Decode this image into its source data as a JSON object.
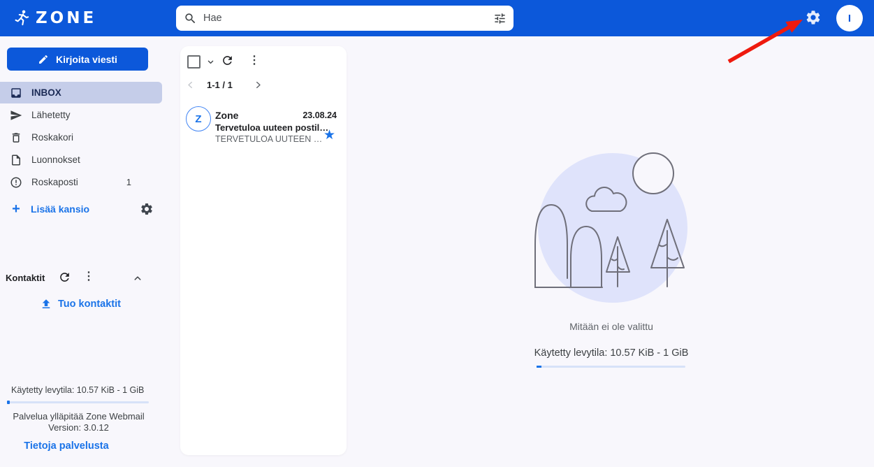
{
  "topbar": {
    "brand": "ZONE",
    "search_placeholder": "Hae",
    "avatar_initial": "I"
  },
  "sidebar": {
    "compose_label": "Kirjoita viesti",
    "folders": [
      {
        "label": "INBOX",
        "selected": true
      },
      {
        "label": "Lähetetty"
      },
      {
        "label": "Roskakori"
      },
      {
        "label": "Luonnokset"
      },
      {
        "label": "Roskaposti",
        "count": "1"
      }
    ],
    "add_folder_label": "Lisää kansio",
    "contacts_title": "Kontaktit",
    "import_contacts_label": "Tuo kontaktit",
    "quota_text": "Käytetty levytila: 10.57 KiB - 1 GiB",
    "maintainer_line1": "Palvelua ylläpitää Zone Webmail",
    "maintainer_line2": "Version: 3.0.12",
    "about_link": "Tietoja palvelusta"
  },
  "message_list": {
    "pagination_range": "1-1 / 1",
    "messages": [
      {
        "avatar_initial": "Z",
        "sender": "Zone",
        "date": "23.08.24",
        "subject": "Tervetuloa uuteen postil…",
        "preview": "TERVETULOA UUTEEN …",
        "starred": true
      }
    ]
  },
  "main": {
    "empty_text": "Mitään ei ole valittu",
    "quota_text": "Käytetty levytila: 10.57 KiB - 1 GiB"
  },
  "icons": {
    "dots_glyph": "⋮",
    "star_glyph": "★",
    "plus_glyph": "+"
  },
  "colors": {
    "topbar_blue": "#0c58da",
    "link_blue": "#1a73e8",
    "selected_folder_bg": "#c5cde9",
    "progress_track": "#d7e2f8",
    "progress_fill": "#1a73e8",
    "annotation_arrow_red": "#ee1a0e",
    "illustration_circle": "#dfe3fb"
  }
}
